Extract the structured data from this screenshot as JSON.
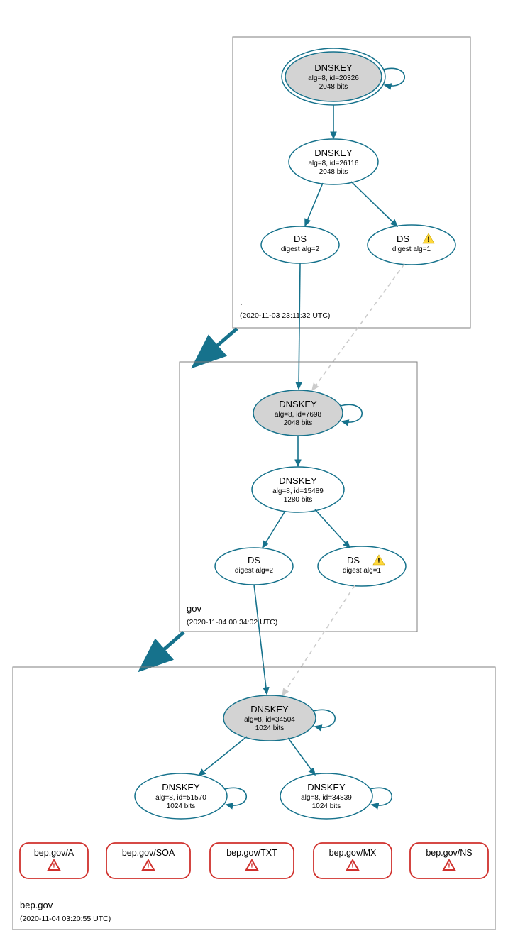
{
  "zones": {
    "root": {
      "name": ".",
      "timestamp": "(2020-11-03 23:11:32 UTC)"
    },
    "gov": {
      "name": "gov",
      "timestamp": "(2020-11-04 00:34:02 UTC)"
    },
    "bep": {
      "name": "bep.gov",
      "timestamp": "(2020-11-04 03:20:55 UTC)"
    }
  },
  "nodes": {
    "root_ksk": {
      "title": "DNSKEY",
      "line1": "alg=8, id=20326",
      "line2": "2048 bits"
    },
    "root_zsk": {
      "title": "DNSKEY",
      "line1": "alg=8, id=26116",
      "line2": "2048 bits"
    },
    "root_ds2": {
      "title": "DS",
      "line1": "digest alg=2"
    },
    "root_ds1": {
      "title": "DS",
      "line1": "digest alg=1"
    },
    "gov_ksk": {
      "title": "DNSKEY",
      "line1": "alg=8, id=7698",
      "line2": "2048 bits"
    },
    "gov_zsk": {
      "title": "DNSKEY",
      "line1": "alg=8, id=15489",
      "line2": "1280 bits"
    },
    "gov_ds2": {
      "title": "DS",
      "line1": "digest alg=2"
    },
    "gov_ds1": {
      "title": "DS",
      "line1": "digest alg=1"
    },
    "bep_ksk": {
      "title": "DNSKEY",
      "line1": "alg=8, id=34504",
      "line2": "1024 bits"
    },
    "bep_zsk1": {
      "title": "DNSKEY",
      "line1": "alg=8, id=51570",
      "line2": "1024 bits"
    },
    "bep_zsk2": {
      "title": "DNSKEY",
      "line1": "alg=8, id=34839",
      "line2": "1024 bits"
    }
  },
  "rrsets": {
    "a": "bep.gov/A",
    "soa": "bep.gov/SOA",
    "txt": "bep.gov/TXT",
    "mx": "bep.gov/MX",
    "ns": "bep.gov/NS"
  }
}
